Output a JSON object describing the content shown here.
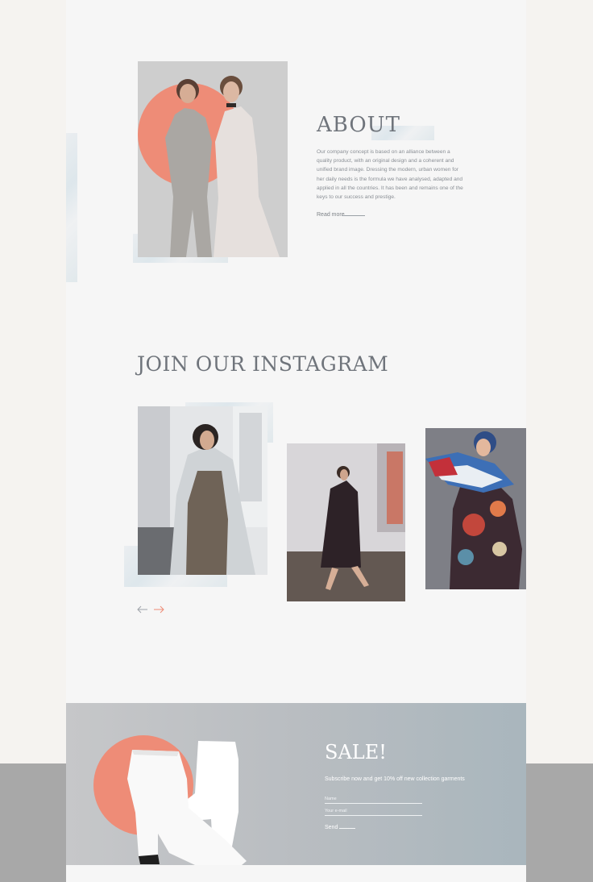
{
  "about": {
    "title": "ABOUT",
    "body": "Our company concept is based on an alliance between a quality product, with an original design and a coherent and unified brand image. Dressing the modern, urban women for her daily needs is the formula we have analysed, adapted and applied in all the countries. It has been and remains one of the keys to our success and prestige.",
    "read_more": "Read more"
  },
  "instagram": {
    "title": "JOIN OUR INSTAGRAM",
    "prev_icon": "arrow-left-icon",
    "next_icon": "arrow-right-icon"
  },
  "sale": {
    "title": "SALE!",
    "subtitle": "Subscribe now and get 10% off new collection garments",
    "name_placeholder": "Name",
    "email_placeholder": "Your e-mail",
    "send_label": "Send"
  },
  "colors": {
    "accent": "#ee8c77",
    "title_gray": "#6f747b",
    "page_bg": "#f6f6f6",
    "sale_bg_start": "#c6c7c9",
    "sale_bg_end": "#a9b6bd"
  }
}
